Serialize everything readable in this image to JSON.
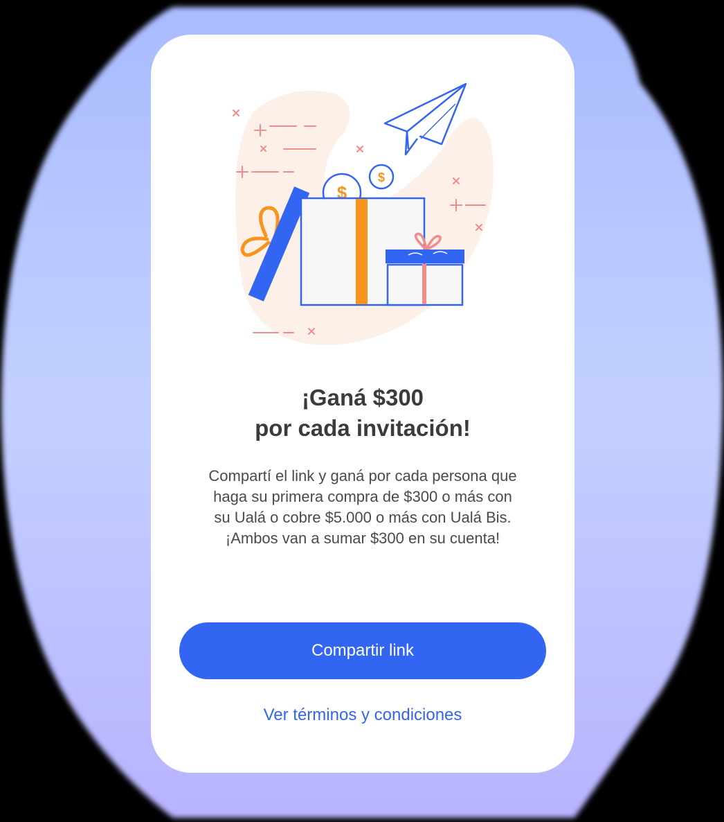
{
  "colors": {
    "accent": "#3265f2",
    "card_background": "#ffffff",
    "title_text": "#3b3b3b",
    "body_text": "#4a4a4a",
    "illustration_orange": "#f7941d",
    "illustration_pink": "#f28b8b",
    "illustration_peach": "#fdf0e8"
  },
  "illustration": {
    "icons": [
      "paper-plane-icon",
      "gift-box-open-icon",
      "gift-box-small-icon",
      "dollar-coin-icon",
      "dollar-coin-icon"
    ],
    "coin_symbol": "$"
  },
  "promo": {
    "title_line1": "¡Ganá $300",
    "title_line2": "por cada invitación!",
    "body_lines": [
      "Compartí el link y ganá por cada persona que",
      "haga su primera compra de $300 o más con",
      "su Ualá o cobre $5.000 o más con Ualá Bis.",
      "¡Ambos van a sumar $300 en su cuenta!"
    ]
  },
  "actions": {
    "share_label": "Compartir link",
    "terms_label": "Ver términos y condiciones"
  }
}
